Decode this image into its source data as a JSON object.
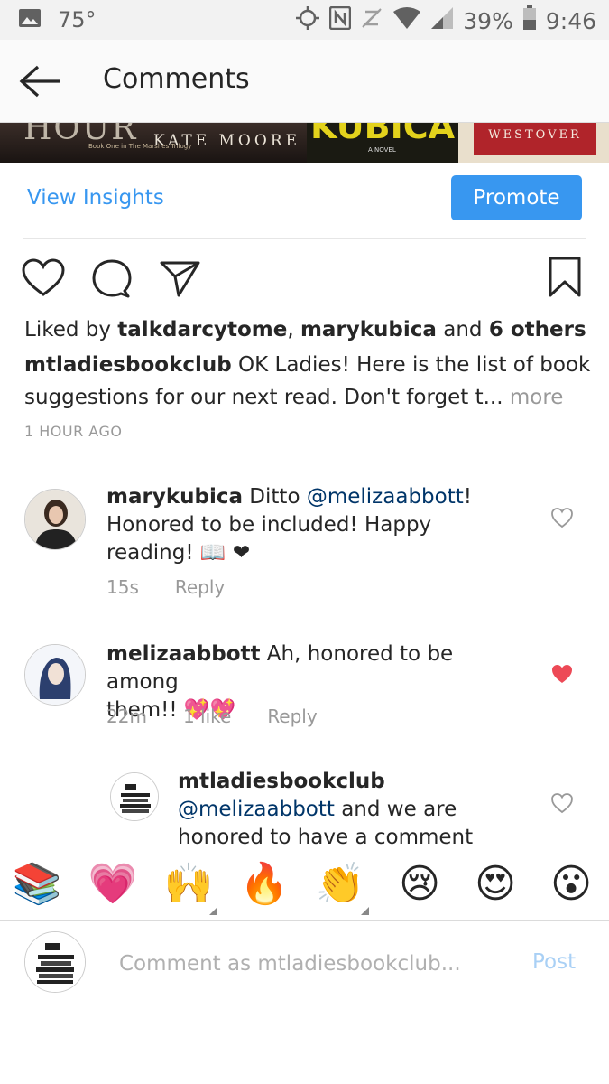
{
  "status_bar": {
    "temperature": "75°",
    "battery": "39%",
    "time": "9:46"
  },
  "app_bar": {
    "title": "Comments"
  },
  "post_image": {
    "book1_title": "HOUR",
    "book1_subtitle": "Book One in The Marshes Trilogy",
    "book1_author": "KATE MOORE",
    "book2_title": "KUBICA",
    "book2_subtitle": "A NOVEL",
    "book3_author": "WESTOVER"
  },
  "insights": {
    "link_label": "View Insights",
    "promote_label": "Promote"
  },
  "caption": {
    "liked_prefix": "Liked by ",
    "liker1": "talkdarcytome",
    "liker_sep": ", ",
    "liker2": "marykubica",
    "and": " and ",
    "others": "6 others",
    "username": "mtladiesbookclub",
    "line1": " OK Ladies! Here is the list of book",
    "line2": "suggestions for our next read. Don't forget t...",
    "more": " more",
    "time_ago": "1 HOUR AGO"
  },
  "comments": [
    {
      "username": "marykubica",
      "text_a": " Ditto ",
      "mention": "@melizaabbott",
      "text_b": "!",
      "line2": "Honored to be included!  Happy",
      "line3": "reading! 📖 ❤",
      "time": "15s",
      "reply": "Reply",
      "liked": false
    },
    {
      "username": "melizaabbott",
      "text_a": " Ah, honored to be among",
      "line2": "them!! 💖💖",
      "time": "22m",
      "likes": "1 like",
      "reply": "Reply",
      "liked": true
    },
    {
      "username": "mtladiesbookclub",
      "mention": "@melizaabbott",
      "text_a": " and we are",
      "line3": "honored to have a comment",
      "liked": false
    }
  ],
  "emoji_bar": {
    "items": [
      "📚",
      "💗",
      "🙌",
      "🔥",
      "👏",
      "😢",
      "😍",
      "😮"
    ]
  },
  "composer": {
    "placeholder": "Comment as mtladiesbookclub...",
    "post_label": "Post"
  },
  "colors": {
    "accent_blue": "#3897f0",
    "like_red": "#ed4956",
    "mention_navy": "#003569"
  }
}
